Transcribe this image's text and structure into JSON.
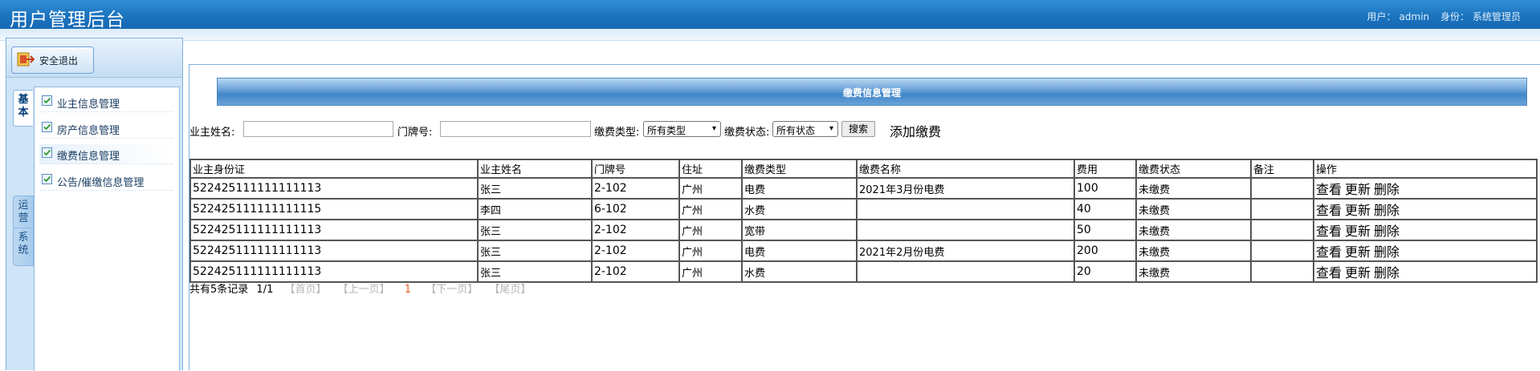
{
  "app": {
    "title": "用户管理后台"
  },
  "user": {
    "label": "用户：",
    "name": "admin",
    "role_label": "身份：",
    "role": "系统管理员"
  },
  "sidebar": {
    "logout_label": "安全退出",
    "tabs": [
      "基本",
      "运营",
      "系统"
    ],
    "items": [
      {
        "label": "业主信息管理"
      },
      {
        "label": "房产信息管理"
      },
      {
        "label": "缴费信息管理"
      },
      {
        "label": "公告/催缴信息管理"
      }
    ]
  },
  "main": {
    "section_title": "缴费信息管理",
    "filters": {
      "owner_label": "业主姓名:",
      "owner_value": "",
      "door_label": "门牌号:",
      "door_value": "",
      "type_label": "缴费类型:",
      "type_selected": "所有类型",
      "status_label": "缴费状态:",
      "status_selected": "所有状态",
      "search_button": "搜索",
      "add_link": "添加缴费"
    },
    "table": {
      "columns": [
        "业主身份证",
        "业主姓名",
        "门牌号",
        "住址",
        "缴费类型",
        "缴费名称",
        "费用",
        "缴费状态",
        "备注",
        "操作"
      ],
      "rows": [
        {
          "id": "522425111111111113",
          "name": "张三",
          "door": "2-102",
          "addr": "广州",
          "type": "电费",
          "fee_name": "2021年3月份电费",
          "amount": "100",
          "status": "未缴费",
          "remark": ""
        },
        {
          "id": "522425111111111115",
          "name": "李四",
          "door": "6-102",
          "addr": "广州",
          "type": "水费",
          "fee_name": "",
          "amount": "40",
          "status": "未缴费",
          "remark": ""
        },
        {
          "id": "522425111111111113",
          "name": "张三",
          "door": "2-102",
          "addr": "广州",
          "type": "宽带",
          "fee_name": "",
          "amount": "50",
          "status": "未缴费",
          "remark": ""
        },
        {
          "id": "522425111111111113",
          "name": "张三",
          "door": "2-102",
          "addr": "广州",
          "type": "电费",
          "fee_name": "2021年2月份电费",
          "amount": "200",
          "status": "未缴费",
          "remark": ""
        },
        {
          "id": "522425111111111113",
          "name": "张三",
          "door": "2-102",
          "addr": "广州",
          "type": "水费",
          "fee_name": "",
          "amount": "20",
          "status": "未缴费",
          "remark": ""
        }
      ],
      "actions": {
        "view": "查看",
        "update": "更新",
        "delete": "删除"
      }
    },
    "pager": {
      "summary": "共有5条记录",
      "pages": "1/1",
      "first": "【首页】",
      "prev": "【上一页】",
      "current": "1",
      "next": "【下一页】",
      "last": "【尾页】"
    }
  },
  "colors": {
    "header_blue": "#1c74bf",
    "pager_current": "#e05a1c"
  },
  "icons": {
    "logout": "exit-door-icon",
    "menu_item": "checkbox-icon"
  }
}
